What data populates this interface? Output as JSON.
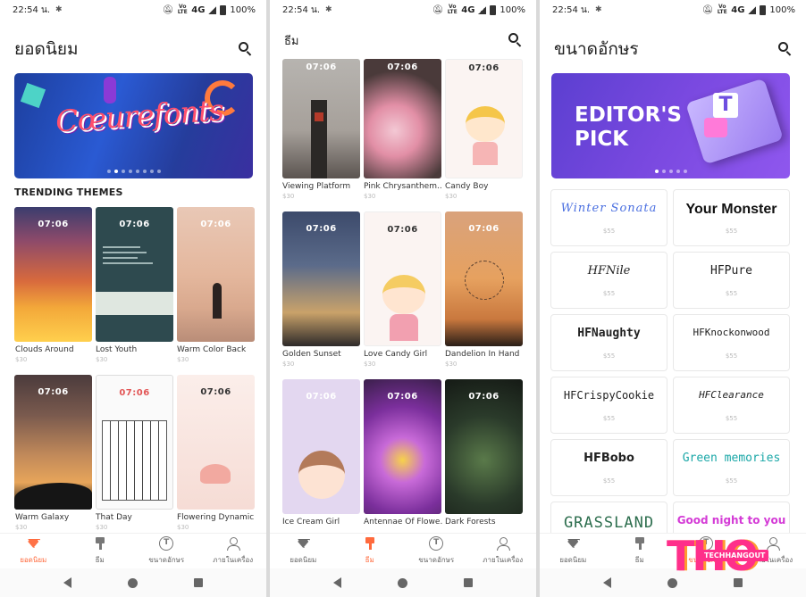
{
  "status": {
    "time": "22:54 น.",
    "network": "4G",
    "battery": "100%",
    "volte": "Vo LTE"
  },
  "screens": {
    "popular": {
      "title": "ยอดนิยม",
      "section_title": "TRENDING THEMES",
      "themes": [
        {
          "name": "Clouds Around",
          "price": "$30",
          "clock": "07:06"
        },
        {
          "name": "Lost Youth",
          "price": "$30",
          "clock": "07:06"
        },
        {
          "name": "Warm Color Back",
          "price": "$30",
          "clock": "07:06"
        },
        {
          "name": "Warm Galaxy",
          "price": "$30",
          "clock": "07:06"
        },
        {
          "name": "That Day",
          "price": "$30",
          "clock": "07:06"
        },
        {
          "name": "Flowering Dynamic",
          "price": "$30",
          "clock": "07:06"
        }
      ]
    },
    "themes": {
      "title": "ธีม",
      "themes": [
        {
          "name": "Viewing Platform",
          "price": "$30",
          "clock": "07:06"
        },
        {
          "name": "Pink Chrysanthem...",
          "price": "$30",
          "clock": "07:06"
        },
        {
          "name": "Candy Boy",
          "price": "$30",
          "clock": "07:06"
        },
        {
          "name": "Golden Sunset",
          "price": "$30",
          "clock": "07:06"
        },
        {
          "name": "Love Candy Girl",
          "price": "$30",
          "clock": "07:06"
        },
        {
          "name": "Dandelion In Hand",
          "price": "$30",
          "clock": "07:06"
        },
        {
          "name": "Ice Cream Girl",
          "price": "",
          "clock": "07:06"
        },
        {
          "name": "Antennae Of Flowe...",
          "price": "",
          "clock": "07:06"
        },
        {
          "name": "Dark Forests",
          "price": "",
          "clock": "07:06"
        }
      ]
    },
    "fonts": {
      "title": "ขนาดอักษร",
      "banner_text": "EDITOR'S PICK",
      "banner_logo": "T",
      "fonts": [
        {
          "name": "Winter Sonata",
          "price": "$55",
          "color": "#4a6fe0"
        },
        {
          "name": "Your Monster",
          "price": "$55",
          "color": "#111111"
        },
        {
          "name": "HFNile",
          "price": "$55",
          "color": "#222222"
        },
        {
          "name": "HFPure",
          "price": "$55",
          "color": "#222222"
        },
        {
          "name": "HFNaughty",
          "price": "$55",
          "color": "#222222"
        },
        {
          "name": "HFKnockonwood",
          "price": "$55",
          "color": "#222222"
        },
        {
          "name": "HFCrispyCookie",
          "price": "$55",
          "color": "#222222"
        },
        {
          "name": "HFClearance",
          "price": "$55",
          "color": "#222222"
        },
        {
          "name": "HFBobo",
          "price": "$55",
          "color": "#222222"
        },
        {
          "name": "Green memories",
          "price": "$55",
          "color": "#1aa7a7"
        },
        {
          "name": "GRASSLAND",
          "price": "",
          "color": "#2d6e4e"
        },
        {
          "name": "Good night to you",
          "price": "",
          "color": "#d43bd6"
        }
      ]
    }
  },
  "banner1_text": "Cœurefonts",
  "nav": {
    "items": [
      {
        "label": "ยอดนิยม",
        "icon": "diamond-icon"
      },
      {
        "label": "ธีม",
        "icon": "brush-icon"
      },
      {
        "label": "ขนาดอักษร",
        "icon": "font-t-icon"
      },
      {
        "label": "ภายในเครื่อง",
        "icon": "user-settings-icon"
      }
    ],
    "active_color": "#ff6a3d"
  },
  "watermark": {
    "logo": "THO",
    "sub": "TECHHANGOUT"
  }
}
